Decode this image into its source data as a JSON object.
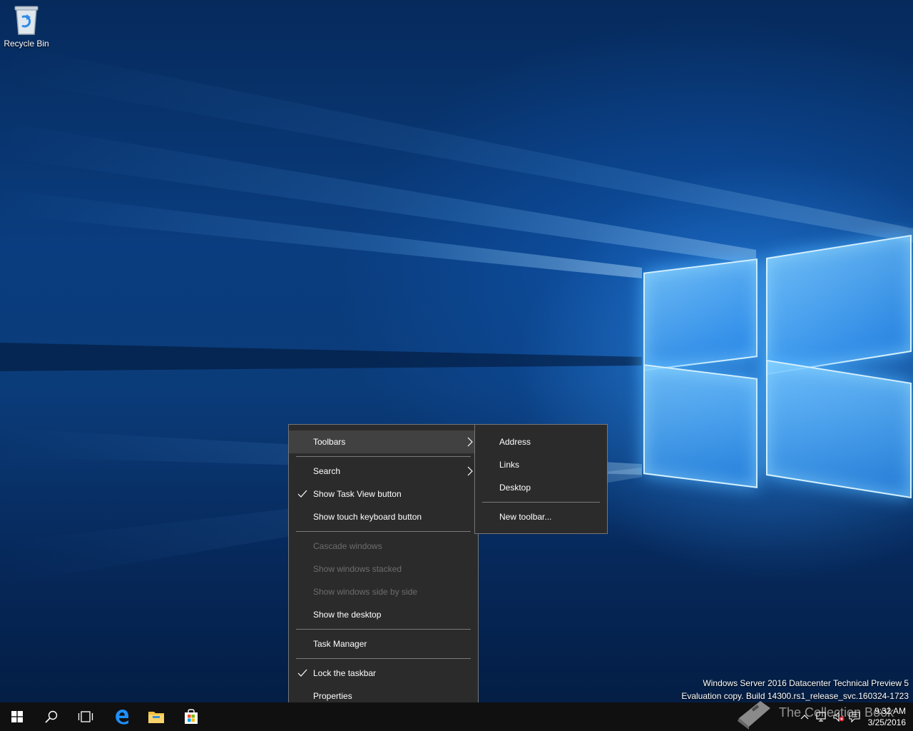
{
  "desktop": {
    "recycle_bin": {
      "label": "Recycle Bin"
    },
    "watermark": {
      "line1": "Windows Server 2016 Datacenter Technical Preview 5",
      "line2": "Evaluation copy. Build 14300.rs1_release_svc.160324-1723"
    }
  },
  "context_menu": {
    "items": [
      {
        "label": "Toolbars",
        "checked": false,
        "submenu": true,
        "disabled": false,
        "highlighted": true
      },
      {
        "label": "Search",
        "checked": false,
        "submenu": true,
        "disabled": false
      },
      {
        "label": "Show Task View button",
        "checked": true,
        "submenu": false,
        "disabled": false
      },
      {
        "label": "Show touch keyboard button",
        "checked": false,
        "submenu": false,
        "disabled": false
      },
      {
        "label": "Cascade windows",
        "checked": false,
        "submenu": false,
        "disabled": true
      },
      {
        "label": "Show windows stacked",
        "checked": false,
        "submenu": false,
        "disabled": true
      },
      {
        "label": "Show windows side by side",
        "checked": false,
        "submenu": false,
        "disabled": true
      },
      {
        "label": "Show the desktop",
        "checked": false,
        "submenu": false,
        "disabled": false
      },
      {
        "label": "Task Manager",
        "checked": false,
        "submenu": false,
        "disabled": false
      },
      {
        "label": "Lock the taskbar",
        "checked": true,
        "submenu": false,
        "disabled": false
      },
      {
        "label": "Properties",
        "checked": false,
        "submenu": false,
        "disabled": false
      }
    ]
  },
  "toolbars_submenu": {
    "items": [
      {
        "label": "Address"
      },
      {
        "label": "Links"
      },
      {
        "label": "Desktop"
      },
      {
        "label": "New toolbar..."
      }
    ]
  },
  "taskbar": {
    "watermark_text": "The Collection Book",
    "clock": {
      "time": "9:32 AM",
      "date": "3/25/2016"
    },
    "icons": [
      "start-icon",
      "search-icon",
      "task-view-icon",
      "edge-icon",
      "file-explorer-icon",
      "store-icon"
    ],
    "tray_icons": [
      "chevron-up-icon",
      "network-icon",
      "volume-muted-icon",
      "action-center-icon"
    ]
  },
  "colors": {
    "menu_bg": "#2b2b2b",
    "menu_highlight": "#414141",
    "taskbar_bg": "#101010",
    "accent": "#1e90ff"
  }
}
